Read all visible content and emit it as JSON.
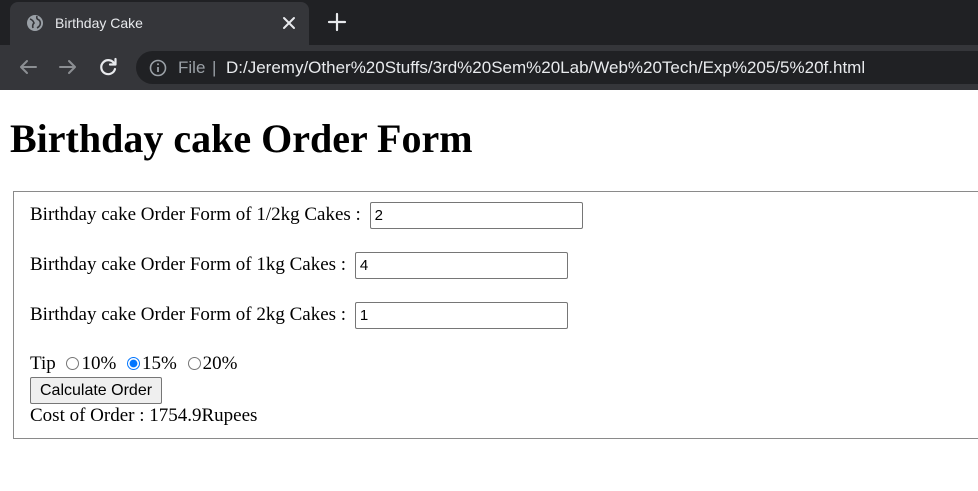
{
  "browser": {
    "tab_title": "Birthday Cake",
    "omnibox": {
      "scheme_label": "File",
      "separator": "|",
      "url": "D:/Jeremy/Other%20Stuffs/3rd%20Sem%20Lab/Web%20Tech/Exp%205/5%20f.html"
    }
  },
  "page": {
    "heading": "Birthday cake Order Form",
    "fields": [
      {
        "label": "Birthday cake Order Form of 1/2kg Cakes :",
        "value": "2"
      },
      {
        "label": "Birthday cake Order Form of 1kg Cakes :",
        "value": "4"
      },
      {
        "label": "Birthday cake Order Form of 2kg Cakes :",
        "value": "1"
      }
    ],
    "tip": {
      "label": "Tip",
      "options": [
        "10%",
        "15%",
        "20%"
      ],
      "selected": "15%"
    },
    "calculate_label": "Calculate Order",
    "result": "Cost of Order : 1754.9Rupees"
  },
  "colors": {
    "tabbar_bg": "#202124",
    "toolbar_bg": "#35363a",
    "radio_accent": "#0075ff"
  },
  "icons": {
    "tab": "globe-icon",
    "tab_close": "close-icon",
    "new_tab": "plus-icon",
    "back": "arrow-left-icon",
    "forward": "arrow-right-icon",
    "reload": "reload-icon",
    "site_info": "info-icon"
  }
}
